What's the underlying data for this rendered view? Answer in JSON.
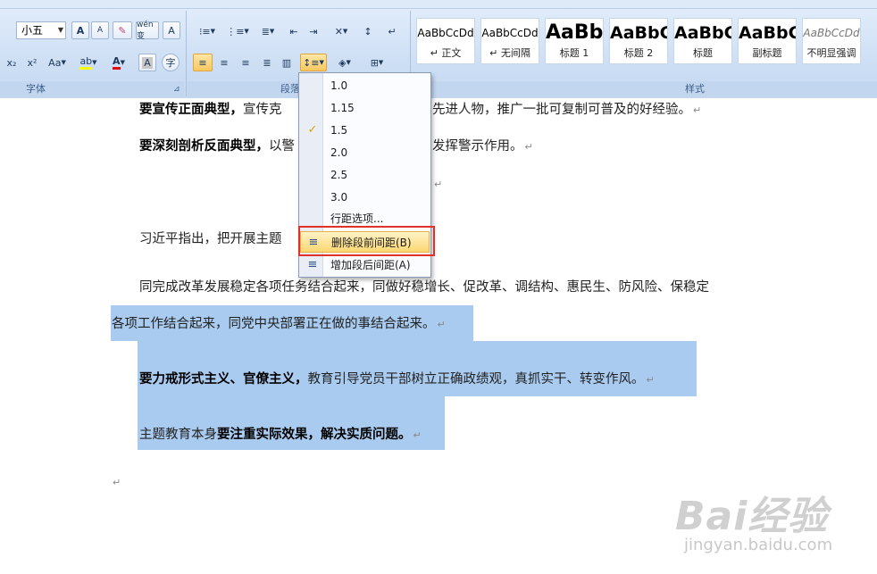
{
  "ribbon": {
    "font_size_value": "小五",
    "groups": {
      "font": "字体",
      "paragraph": "段落",
      "styles": "样式"
    },
    "font_buttons": {
      "grow": "A",
      "shrink": "A",
      "phonetic": "ab",
      "wen": "wén变",
      "border_char": "A",
      "subscript": "x₂",
      "superscript": "x²",
      "change_case": "Aa",
      "highlight": "ab",
      "font_color": "A",
      "shade": "A",
      "enclose": "字"
    },
    "styles": [
      {
        "sample": "AaBbCcDd",
        "name": "↵ 正文"
      },
      {
        "sample": "AaBbCcDd",
        "name": "↵ 无间隔"
      },
      {
        "sample": "AaBb",
        "name": "标题 1"
      },
      {
        "sample": "AaBbC",
        "name": "标题 2"
      },
      {
        "sample": "AaBbC",
        "name": "标题"
      },
      {
        "sample": "AaBbC",
        "name": "副标题"
      },
      {
        "sample": "AaBbCcDd",
        "name": "不明显强调"
      }
    ]
  },
  "document": {
    "line1_bold": "要宣传正面典型，",
    "line1_rest": "宣传克",
    "line1_tail": "先进人物，推广一批可复制可普及的好经验。",
    "line2_bold": "要深刻剖析反面典型，",
    "line2_rest": "以警",
    "line2_tail": "发挥警示作用。",
    "line4": "习近平指出，把开展主题",
    "line5": "同完成改革发展稳定各项任务结合起来，同做好稳增长、促改革、调结构、惠民生、防风险、保稳定",
    "line6": "各项工作结合起来，同党中央部署正在做的事结合起来。",
    "line7_bold": "要力戒形式主义、官僚主义，",
    "line7_rest": "教育引导党员干部树立正确政绩观，真抓实干、转变作风。",
    "line8_rest": "主题教育本身",
    "line8_bold": "要注重实际效果，解决实质问题。",
    "pilcrow": "↵"
  },
  "menu": {
    "items": [
      {
        "label": "1.0",
        "checked": false
      },
      {
        "label": "1.15",
        "checked": false
      },
      {
        "label": "1.5",
        "checked": true
      },
      {
        "label": "2.0",
        "checked": false
      },
      {
        "label": "2.5",
        "checked": false
      },
      {
        "label": "3.0",
        "checked": false
      }
    ],
    "options": "行距选项...",
    "remove_before": "删除段前间距(B)",
    "add_after": "增加段后间距(A)",
    "checkmark": "✓"
  },
  "watermark": {
    "logo": "Bai经验",
    "url": "jingyan.baidu.com"
  },
  "colors": {
    "selection": "#a9cbf0",
    "highlight_border": "#e0322a",
    "ribbon": "#cfe0f5"
  }
}
